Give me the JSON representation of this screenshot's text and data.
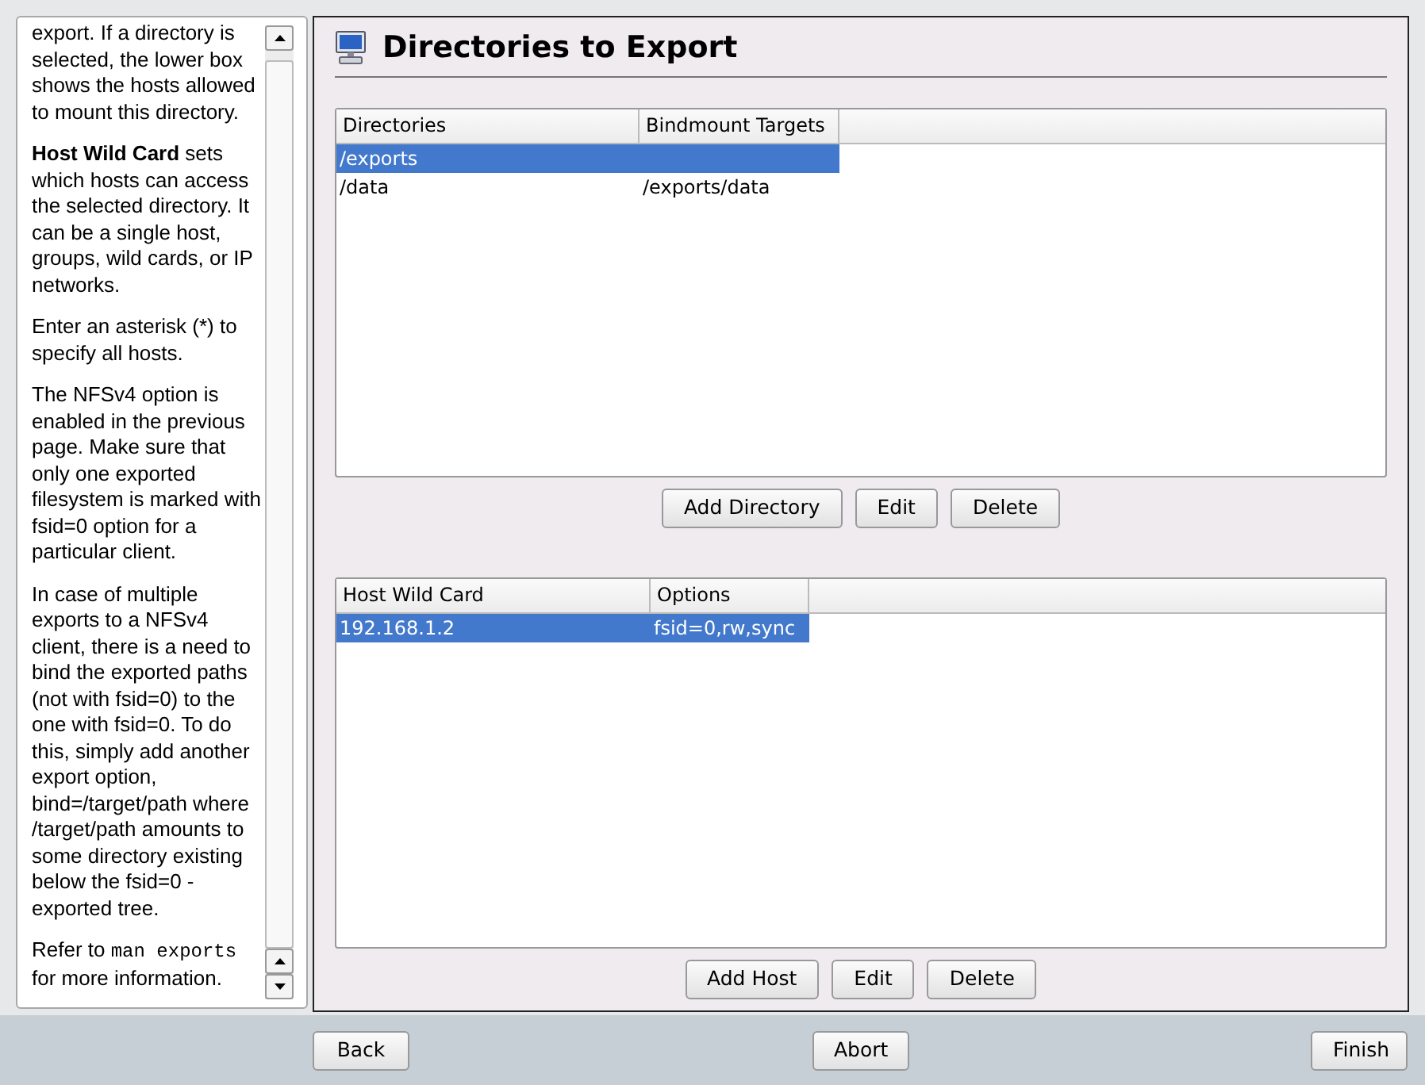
{
  "help": {
    "paragraphs": [
      {
        "segments": [
          {
            "kind": "text",
            "text": "export. If a directory is selected, the lower box shows the hosts allowed to mount this directory."
          }
        ]
      },
      {
        "segments": [
          {
            "kind": "text",
            "text": "**Host Wild Card** sets which hosts can access the selected directory. It can be a single host, groups, wild cards, or IP networks."
          }
        ]
      },
      {
        "segments": [
          {
            "kind": "text",
            "text": "Enter an asterisk (*) to specify all hosts."
          }
        ]
      },
      {
        "segments": [
          {
            "kind": "text",
            "text": "The NFSv4 option is enabled in the previous page. Make sure that only one exported filesystem is marked with fsid=0 option for a particular client."
          }
        ]
      },
      {
        "segments": [
          {
            "kind": "text",
            "text": "In case of multiple exports to a NFSv4 client, there is a need to bind the exported paths (not with fsid=0) to the one with fsid=0. To do this, simply add another export option, bind=/target/path where /target/path amounts to some directory existing below the fsid=0 - exported tree."
          }
        ]
      },
      {
        "segments": [
          {
            "kind": "text",
            "text": "Refer to "
          },
          {
            "kind": "code",
            "text": "man exports"
          },
          {
            "kind": "text",
            "text": " for more information."
          }
        ]
      }
    ]
  },
  "title": "Directories to Export",
  "directories": {
    "columns": [
      "Directories",
      "Bindmount Targets"
    ],
    "rows": [
      {
        "cells": [
          "/exports",
          ""
        ],
        "selected": true
      },
      {
        "cells": [
          "/data",
          "/exports/data"
        ],
        "selected": false
      }
    ],
    "buttons": [
      {
        "label": "Add Directory"
      },
      {
        "label": "Edit"
      },
      {
        "label": "Delete"
      }
    ]
  },
  "hosts": {
    "columns": [
      "Host Wild Card",
      "Options"
    ],
    "rows": [
      {
        "cells": [
          "192.168.1.2",
          "fsid=0,rw,sync"
        ],
        "selected": true
      }
    ],
    "buttons": [
      {
        "label": "Add Host"
      },
      {
        "label": "Edit"
      },
      {
        "label": "Delete"
      }
    ]
  },
  "footer": [
    {
      "label": "Back"
    },
    {
      "label": "Abort"
    },
    {
      "label": "Finish"
    }
  ]
}
